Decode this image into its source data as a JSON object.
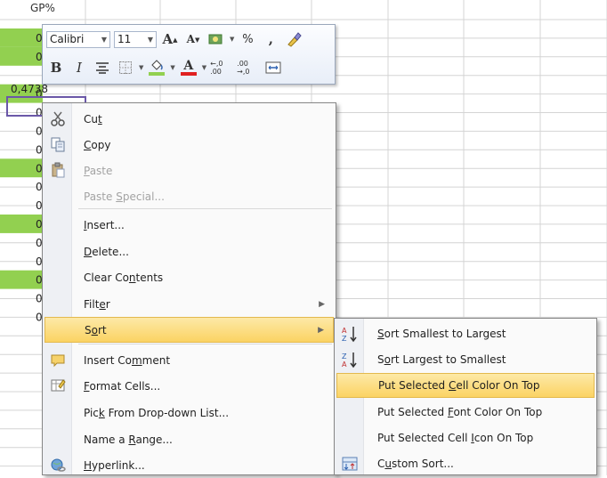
{
  "sheet": {
    "header_label": "GP%",
    "visible_value": "0,4738",
    "row_prefix": "0",
    "green_rows": [
      1,
      2,
      4,
      8,
      11,
      14
    ],
    "colors": {
      "green": "#92d050",
      "grid": "#d4d4d4",
      "selection_border": "#6b58a8"
    }
  },
  "mini_toolbar": {
    "font_name": "Calibri",
    "font_size": "11",
    "grow_font": "A",
    "shrink_font": "A",
    "percent": "%",
    "comma": ",",
    "bold": "B",
    "italic": "I",
    "font_color_letter": "A",
    "increase_decimal": "←,0 .00",
    "decrease_decimal": ".00 →,0"
  },
  "context_menu": {
    "items": [
      {
        "label_pre": "Cu",
        "label_u": "t",
        "label_post": "",
        "icon": "scissors-icon",
        "enabled": true
      },
      {
        "label_pre": "",
        "label_u": "C",
        "label_post": "opy",
        "icon": "copy-icon",
        "enabled": true
      },
      {
        "label_pre": "",
        "label_u": "P",
        "label_post": "aste",
        "icon": "paste-icon",
        "enabled": false
      },
      {
        "label_pre": "Paste ",
        "label_u": "S",
        "label_post": "pecial...",
        "icon": "",
        "enabled": false
      },
      {
        "label_pre": "",
        "label_u": "I",
        "label_post": "nsert...",
        "icon": "",
        "enabled": true
      },
      {
        "label_pre": "",
        "label_u": "D",
        "label_post": "elete...",
        "icon": "",
        "enabled": true
      },
      {
        "label_pre": "Clear Co",
        "label_u": "n",
        "label_post": "tents",
        "icon": "",
        "enabled": true
      },
      {
        "label_pre": "Filt",
        "label_u": "e",
        "label_post": "r",
        "icon": "",
        "enabled": true,
        "submenu": true
      },
      {
        "label_pre": "S",
        "label_u": "o",
        "label_post": "rt",
        "icon": "",
        "enabled": true,
        "submenu": true,
        "highlighted": true
      },
      {
        "label_pre": "Insert Co",
        "label_u": "m",
        "label_post": "ment",
        "icon": "comment-icon",
        "enabled": true
      },
      {
        "label_pre": "",
        "label_u": "F",
        "label_post": "ormat Cells...",
        "icon": "format-cells-icon",
        "enabled": true
      },
      {
        "label_pre": "Pic",
        "label_u": "k",
        "label_post": " From Drop-down List...",
        "icon": "",
        "enabled": true
      },
      {
        "label_pre": "Name a ",
        "label_u": "R",
        "label_post": "ange...",
        "icon": "",
        "enabled": true
      },
      {
        "label_pre": "",
        "label_u": "H",
        "label_post": "yperlink...",
        "icon": "hyperlink-icon",
        "enabled": true
      }
    ]
  },
  "sort_submenu": {
    "items": [
      {
        "label_pre": "",
        "label_u": "S",
        "label_post": "ort Smallest to Largest",
        "icon": "sort-az-icon"
      },
      {
        "label_pre": "S",
        "label_u": "o",
        "label_post": "rt Largest to Smallest",
        "icon": "sort-za-icon"
      },
      {
        "label_pre": "Put Selected ",
        "label_u": "C",
        "label_post": "ell Color On Top",
        "icon": "",
        "highlighted": true
      },
      {
        "label_pre": "Put Selected ",
        "label_u": "F",
        "label_post": "ont Color On Top",
        "icon": ""
      },
      {
        "label_pre": "Put Selected Cell ",
        "label_u": "I",
        "label_post": "con On Top",
        "icon": ""
      },
      {
        "label_pre": "C",
        "label_u": "u",
        "label_post": "stom Sort...",
        "icon": "custom-sort-icon"
      }
    ]
  }
}
